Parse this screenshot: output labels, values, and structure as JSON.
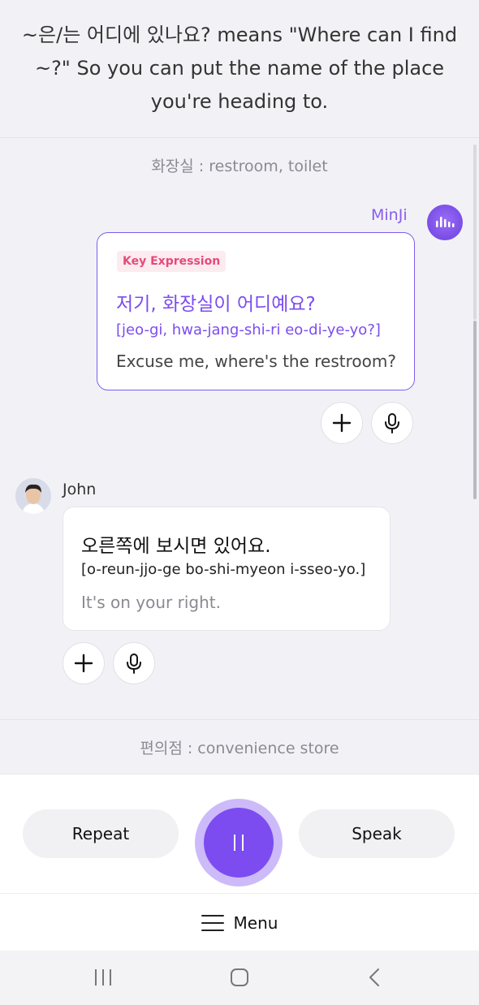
{
  "intro": {
    "text": "~은/는 어디에 있나요? means \"Where can I find ~?\" So you can put the name of the place you're heading to."
  },
  "sections": [
    {
      "label": "화장실 : restroom, toilet"
    },
    {
      "label": "편의점 : convenience store"
    }
  ],
  "messages": [
    {
      "speaker": "MinJi",
      "tag": "Key Expression",
      "korean": "저기, 화장실이 어디예요?",
      "romanization": "[jeo-gi, hwa-jang-shi-ri eo-di-ye-yo?]",
      "english": "Excuse me, where's the restroom?"
    },
    {
      "speaker": "John",
      "korean": "오른쪽에 보시면 있어요.",
      "romanization": "[o-reun-jjo-ge bo-shi-myeon i-sseo-yo.]",
      "english": "It's on your right."
    }
  ],
  "controls": {
    "repeat_label": "Repeat",
    "speak_label": "Speak",
    "menu_label": "Menu"
  },
  "icons": {
    "add": "plus-icon",
    "mic": "microphone-icon",
    "pause": "pause-icon",
    "menu": "hamburger-icon",
    "nav_recents": "recent-apps-icon",
    "nav_home": "home-icon",
    "nav_back": "back-icon"
  },
  "colors": {
    "accent": "#7c4cf0",
    "minji_name": "#8a5cf0",
    "tag_text": "#e54a7a",
    "tag_bg": "#fdecef"
  }
}
